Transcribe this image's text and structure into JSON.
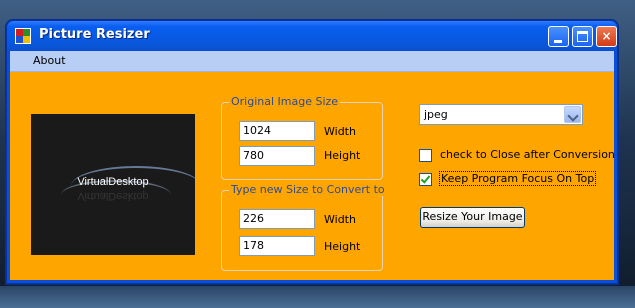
{
  "window": {
    "title": "Picture Resizer",
    "controls": {
      "minimize": "minimize",
      "maximize": "maximize",
      "close": "×"
    }
  },
  "menu": {
    "items": [
      {
        "label": "About"
      }
    ]
  },
  "preview": {
    "caption": "VirtualDesktop"
  },
  "original_size": {
    "legend": "Original Image Size",
    "width_value": "1024",
    "width_label": "Width",
    "height_value": "780",
    "height_label": "Height"
  },
  "new_size": {
    "legend": "Type new Size to Convert to",
    "width_value": "226",
    "width_label": "Width",
    "height_value": "178",
    "height_label": "Height"
  },
  "format_select": {
    "selected": "jpeg"
  },
  "options": {
    "close_after": {
      "label": "check to Close after Conversion",
      "checked": false
    },
    "keep_on_top": {
      "label": "Keep Program Focus On Top",
      "checked": true
    }
  },
  "actions": {
    "resize_label": "Resize Your Image"
  },
  "colors": {
    "client_background": "#ffa500",
    "titlebar": "#0a5ef0",
    "menubar": "#b8cef4",
    "group_legend_text": "#2a4b9a"
  },
  "icons": {
    "app": "app-icon",
    "minimize": "minimize-icon",
    "maximize": "maximize-icon",
    "close": "close-icon",
    "dropdown": "chevron-down-icon",
    "checkmark": "checkmark-icon"
  }
}
